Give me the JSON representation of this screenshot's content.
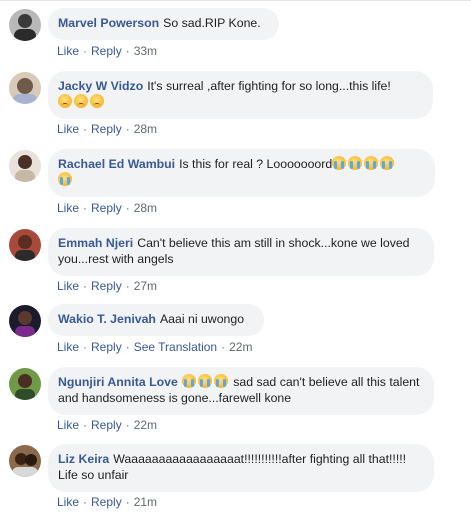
{
  "comments": [
    {
      "author": "Marvel Powerson",
      "text": "So sad.RIP Kone.",
      "emojis": "",
      "actions": {
        "like": "Like",
        "reply": "Reply",
        "time": "33m"
      }
    },
    {
      "author": "Jacky W Vidzo",
      "text": "It's surreal ,after fighting for so long...this life!",
      "emojis": "sad sad sad",
      "actions": {
        "like": "Like",
        "reply": "Reply",
        "time": "28m"
      }
    },
    {
      "author": "Rachael Ed Wambui",
      "text": "Is this for real ? Looooooord",
      "emojis": "cry cry cry cry cry",
      "actions": {
        "like": "Like",
        "reply": "Reply",
        "time": "28m"
      }
    },
    {
      "author": "Emmah Njeri",
      "text": "Can't believe this am still in shock...kone we loved you...rest with angels",
      "emojis": "",
      "actions": {
        "like": "Like",
        "reply": "Reply",
        "time": "27m"
      }
    },
    {
      "author": "Wakio T. Jenivah",
      "text": "Aaai ni uwongo",
      "emojis": "",
      "actions": {
        "like": "Like",
        "reply": "Reply",
        "translate": "See Translation",
        "time": "22m"
      }
    },
    {
      "author": "Ngunjiri Annita Love",
      "text": "sad sad can't believe all this talent and handsomeness is gone...farewell kone",
      "emojis": "cry cry cry",
      "actions": {
        "like": "Like",
        "reply": "Reply",
        "time": "22m"
      }
    },
    {
      "author": "Liz Keira",
      "text": "Waaaaaaaaaaaaaaaaat!!!!!!!!!!!after fighting all that!!!!! Life so unfair",
      "emojis": "",
      "actions": {
        "like": "Like",
        "reply": "Reply",
        "time": "21m"
      }
    }
  ],
  "colors": {
    "link": "#385898",
    "bubble": "#f2f3f5",
    "meta": "#606770",
    "text": "#1c1e21"
  }
}
